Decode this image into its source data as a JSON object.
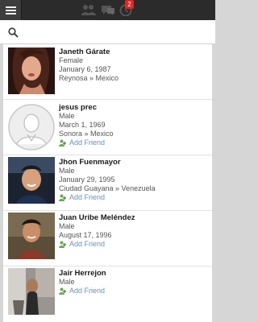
{
  "topbar": {
    "icons": [
      "menu-icon",
      "friends-icon",
      "messages-icon",
      "notifications-icon"
    ],
    "notification_count": "2",
    "background": "#2b2b2b",
    "badge_color": "#d72a2a"
  },
  "search": {
    "placeholder": "",
    "value": ""
  },
  "people": [
    {
      "name": "Janeth Gárate",
      "gender": "Female",
      "birthday": "January 6, 1987",
      "location": "Reynosa » Mexico",
      "action": ""
    },
    {
      "name": "jesus prec",
      "gender": "Male",
      "birthday": "March 1, 1969",
      "location": "Sonora » Mexico",
      "action": "Add Friend"
    },
    {
      "name": "Jhon Fuenmayor",
      "gender": "Male",
      "birthday": "January 29, 1995",
      "location": "Ciudad Guayana » Venezuela",
      "action": "Add Friend"
    },
    {
      "name": "Juan Uribe Meléndez",
      "gender": "Male",
      "birthday": "August 17, 1996",
      "location": "",
      "action": "Add Friend"
    },
    {
      "name": "Jair Herrejon",
      "gender": "Male",
      "birthday": "",
      "location": "",
      "action": "Add Friend"
    }
  ],
  "colors": {
    "link": "#6b8fb8",
    "text": "#555555"
  }
}
